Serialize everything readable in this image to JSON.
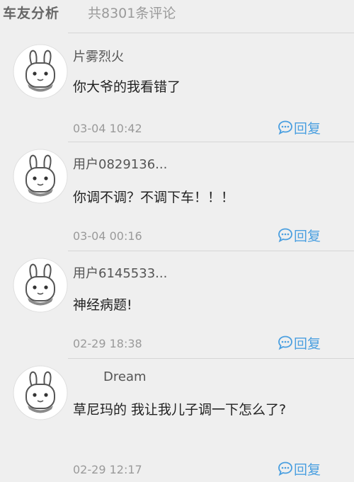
{
  "header": {
    "title": "车友分析",
    "count": "共8301条评论"
  },
  "colors": {
    "accent": "#4a9fe0",
    "background": "#efefef",
    "muted_text": "#9a9a9a"
  },
  "comments": [
    {
      "username": "片雾烈火",
      "content": "你大爷的我看错了",
      "time": "03-04 10:42",
      "reply_label": "回复",
      "avatar_icon": "bunny-avatar-icon",
      "reply_icon": "chat-bubble-icon"
    },
    {
      "username": "用户0829136...",
      "content": "你调不调？不调下车！！！",
      "time": "03-04 00:16",
      "reply_label": "回复",
      "avatar_icon": "bunny-avatar-icon",
      "reply_icon": "chat-bubble-icon"
    },
    {
      "username": "用户6145533...",
      "content": "神经病题!",
      "time": "02-29 18:38",
      "reply_label": "回复",
      "avatar_icon": "bunny-avatar-icon",
      "reply_icon": "chat-bubble-icon"
    },
    {
      "username": "Dream",
      "content": "草尼玛的 我让我儿子调一下怎么了?",
      "time": "02-29 12:17",
      "reply_label": "回复",
      "avatar_icon": "bunny-avatar-icon",
      "reply_icon": "chat-bubble-icon"
    }
  ]
}
